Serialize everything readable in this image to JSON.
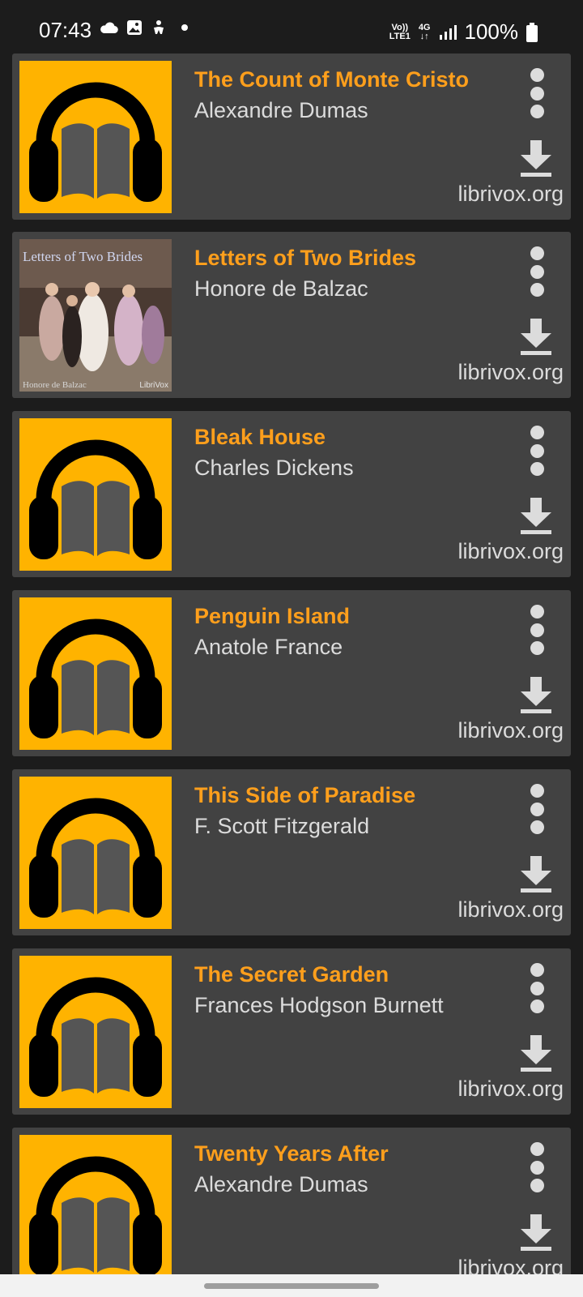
{
  "status_bar": {
    "time": "07:43",
    "volte_label": "Vo))",
    "lte_label": "LTE1",
    "network_label": "4G",
    "battery": "100%"
  },
  "books": [
    {
      "title": "The Count of Monte Cristo",
      "author": "Alexandre Dumas",
      "source": "librivox.org",
      "cover": "headphones-book-icon"
    },
    {
      "title": "Letters of Two Brides",
      "author": "Honore de Balzac",
      "source": "librivox.org",
      "cover": "painting",
      "cover_title": "Letters of Two Brides",
      "cover_author": "Honore de Balzac",
      "cover_brand": "LibriVox"
    },
    {
      "title": "Bleak House",
      "author": "Charles Dickens",
      "source": "librivox.org",
      "cover": "headphones-book-icon"
    },
    {
      "title": "Penguin Island",
      "author": "Anatole France",
      "source": "librivox.org",
      "cover": "headphones-book-icon"
    },
    {
      "title": "This Side of Paradise",
      "author": "F. Scott Fitzgerald",
      "source": "librivox.org",
      "cover": "headphones-book-icon"
    },
    {
      "title": "The Secret Garden",
      "author": "Frances Hodgson Burnett",
      "source": "librivox.org",
      "cover": "headphones-book-icon"
    },
    {
      "title": "Twenty Years After",
      "author": "Alexandre Dumas",
      "source": "librivox.org",
      "cover": "headphones-book-icon"
    }
  ],
  "colors": {
    "accent_title": "#ff9f1c",
    "cover_yellow": "#ffb300",
    "card_bg": "#424242",
    "page_bg": "#1c1c1c"
  }
}
